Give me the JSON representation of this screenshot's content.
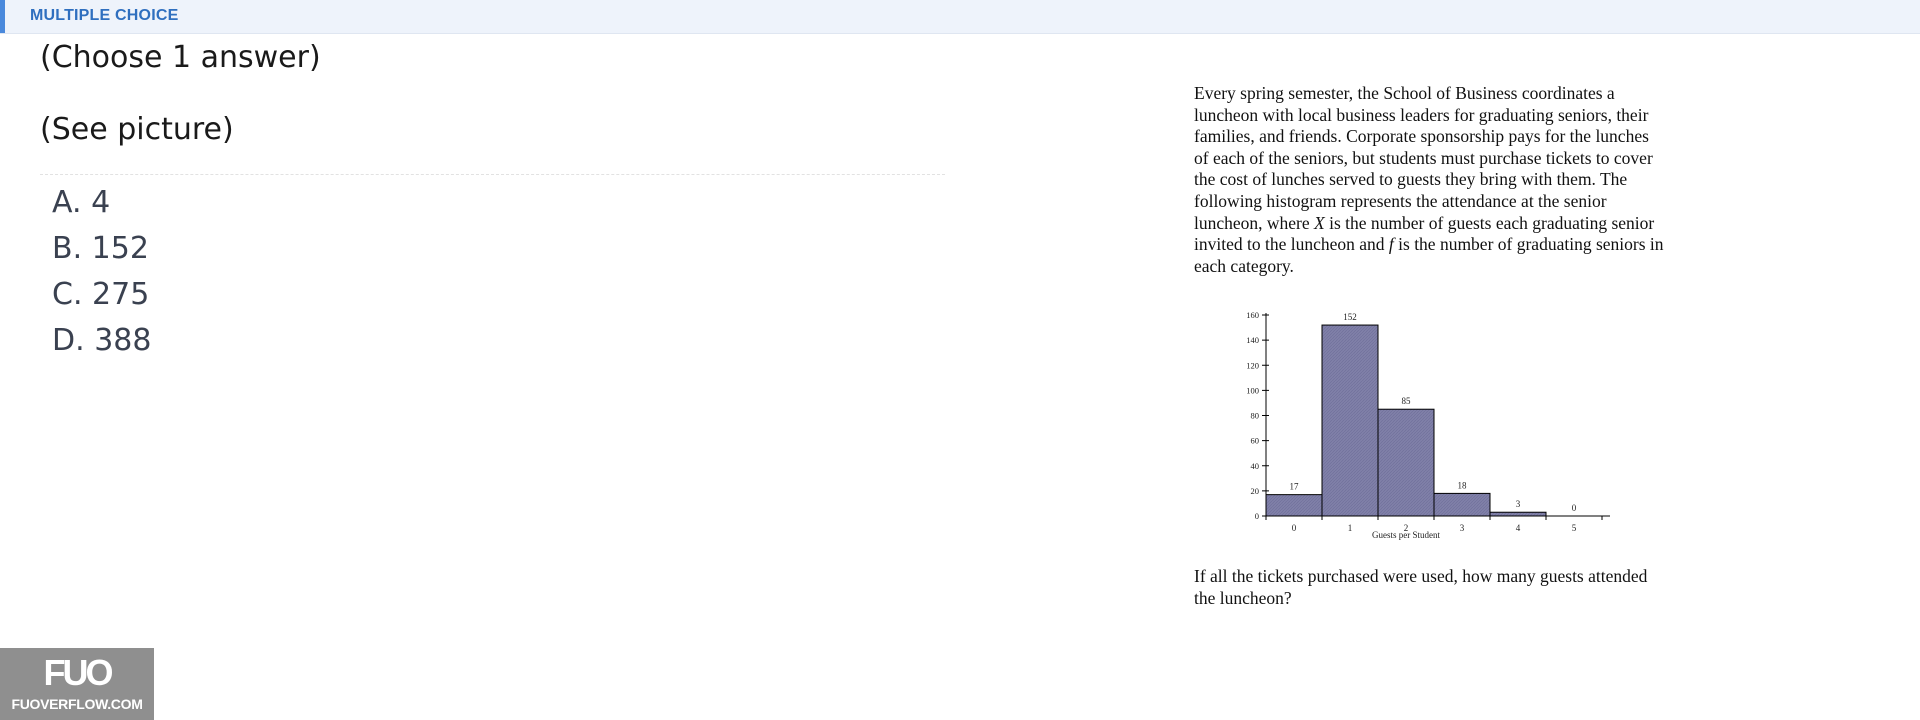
{
  "header": {
    "title": "MULTIPLE CHOICE",
    "accent_color": "#4a89dc"
  },
  "question": {
    "instruction": "(Choose 1 answer)",
    "picture_note": "(See picture)",
    "options": [
      {
        "letter": "A.",
        "value": "4"
      },
      {
        "letter": "B.",
        "value": "152"
      },
      {
        "letter": "C.",
        "value": "275"
      },
      {
        "letter": "D.",
        "value": "388"
      }
    ]
  },
  "picture": {
    "passage_part1": "Every spring semester, the School of Business coordinates a luncheon with local business leaders for graduating seniors, their families, and friends. Corporate sponsorship pays for the lunches of each of the seniors, but students must purchase tickets to cover the cost of lunches served to guests they bring with them. The following histogram represents the attendance at the senior luncheon, where ",
    "var_x": "X",
    "passage_part2": " is the number of guests each graduating senior invited to the luncheon and ",
    "var_f": "f",
    "passage_part3": " is the number of graduating seniors in each category.",
    "question_text": "If all the tickets purchased were used, how many guests attended the luncheon?"
  },
  "chart_data": {
    "type": "bar",
    "categories": [
      "0",
      "1",
      "2",
      "3",
      "4",
      "5"
    ],
    "values": [
      17,
      152,
      85,
      18,
      3,
      0
    ],
    "xlabel": "Guests per Student",
    "ylabel": "",
    "ylim": [
      0,
      160
    ],
    "yticks": [
      0,
      20,
      40,
      60,
      80,
      100,
      120,
      140,
      160
    ],
    "bar_color": "#8080a8",
    "grid": false
  },
  "watermark": {
    "logo": "FUO",
    "text": "FUOVERFLOW.COM"
  }
}
